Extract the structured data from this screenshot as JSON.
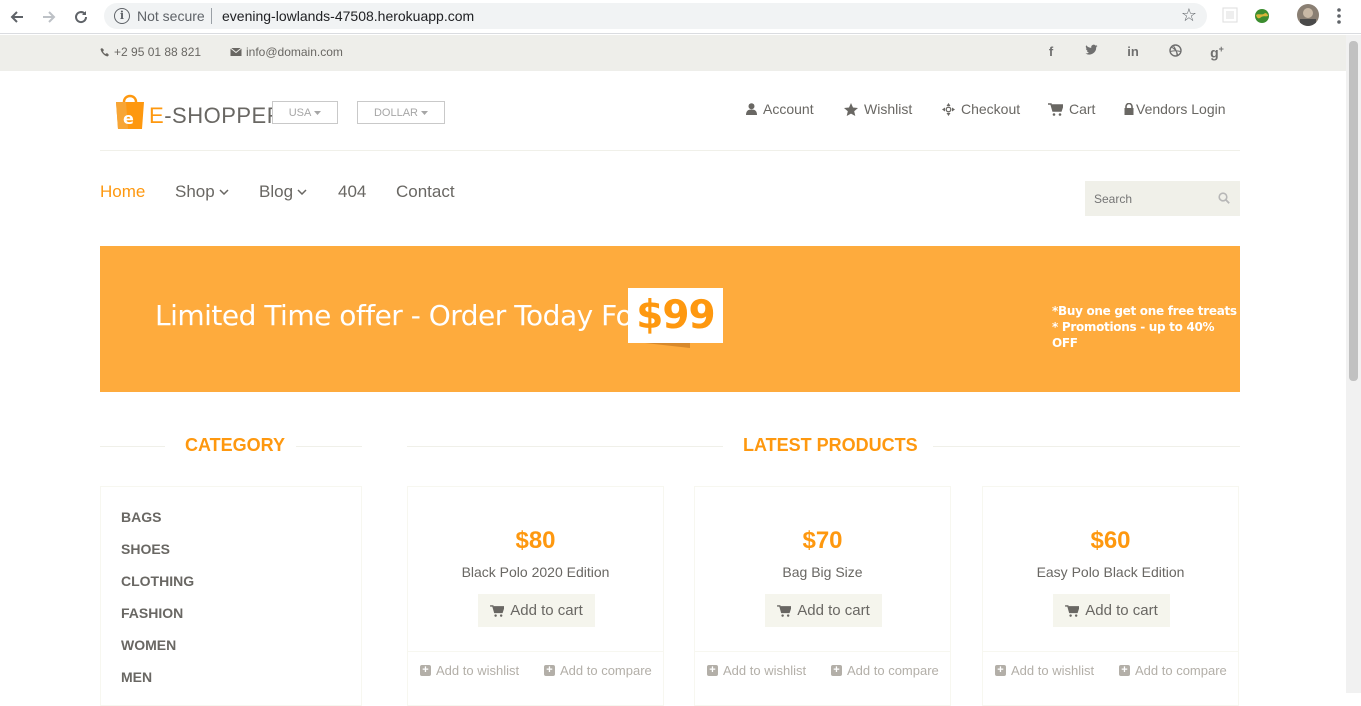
{
  "browser": {
    "security_label": "Not secure",
    "url": "evening-lowlands-47508.herokuapp.com"
  },
  "topbar": {
    "phone": "+2 95 01 88 821",
    "email": "info@domain.com",
    "social": [
      "facebook-icon",
      "twitter-icon",
      "linkedin-icon",
      "dribbble-icon",
      "google-plus-icon"
    ]
  },
  "header": {
    "logo_text": "E-SHOPPER",
    "country": "USA",
    "currency": "DOLLAR",
    "user_nav": [
      {
        "label": "Account",
        "icon": "user-icon"
      },
      {
        "label": "Wishlist",
        "icon": "star-icon"
      },
      {
        "label": "Checkout",
        "icon": "crosshairs-icon"
      },
      {
        "label": "Cart",
        "icon": "cart-icon"
      },
      {
        "label": "Vendors Login",
        "icon": "lock-icon"
      }
    ]
  },
  "menu": {
    "items": [
      {
        "label": "Home",
        "active": true
      },
      {
        "label": "Shop",
        "dropdown": true
      },
      {
        "label": "Blog",
        "dropdown": true
      },
      {
        "label": "404"
      },
      {
        "label": "Contact"
      }
    ],
    "search_placeholder": "Search"
  },
  "banner": {
    "headline": "Limited Time offer - Order Today For",
    "price": "$99",
    "note1": "*Buy one get one free treats",
    "note2": "* Promotions - up to 40% OFF"
  },
  "category": {
    "title": "CATEGORY",
    "items": [
      "BAGS",
      "SHOES",
      "CLOTHING",
      "FASHION",
      "WOMEN",
      "MEN"
    ]
  },
  "products": {
    "title": "LATEST PRODUCTS",
    "items": [
      {
        "price": "$80",
        "name": "Black Polo 2020 Edition",
        "cart": "Add to cart",
        "wishlist": "Add to wishlist",
        "compare": "Add to compare"
      },
      {
        "price": "$70",
        "name": "Bag Big Size",
        "cart": "Add to cart",
        "wishlist": "Add to wishlist",
        "compare": "Add to compare"
      },
      {
        "price": "$60",
        "name": "Easy Polo Black Edition",
        "cart": "Add to cart",
        "wishlist": "Add to wishlist",
        "compare": "Add to compare"
      }
    ]
  },
  "colors": {
    "accent": "#FE980F",
    "banner": "#FEAB3D",
    "text": "#696763",
    "topbar": "#eeeeea"
  }
}
